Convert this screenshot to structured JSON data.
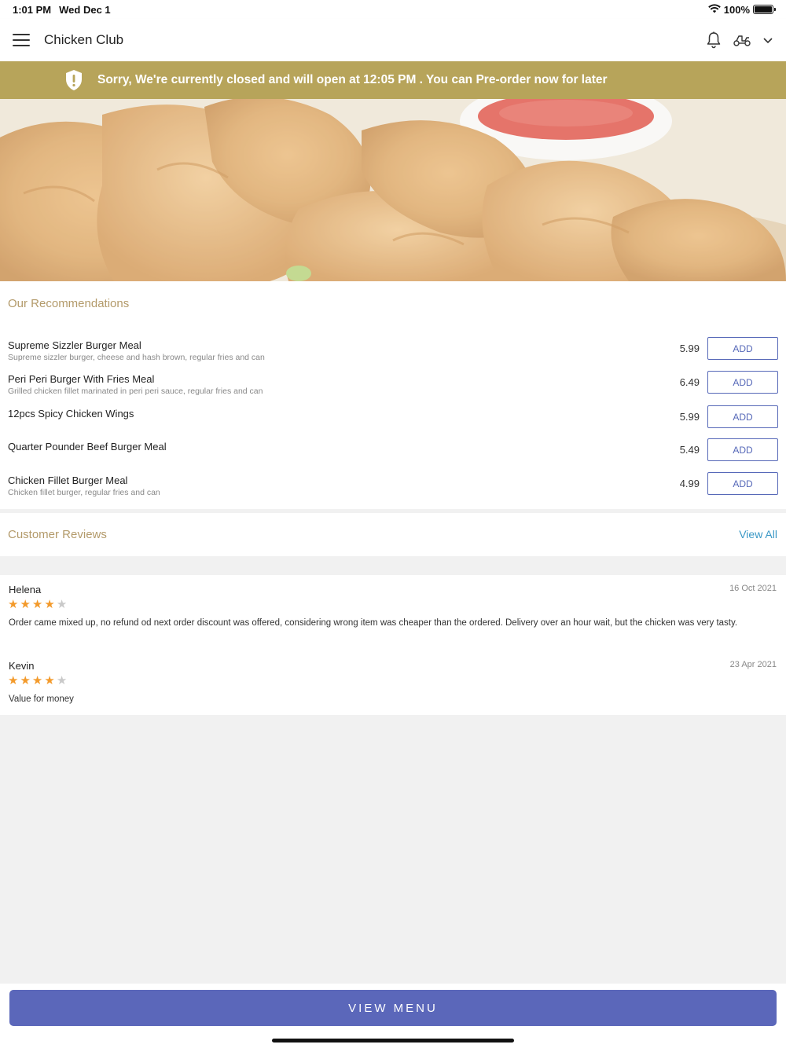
{
  "status_bar": {
    "time": "1:01 PM",
    "date": "Wed Dec 1",
    "battery": "100%"
  },
  "header": {
    "title": "Chicken Club",
    "icons": [
      "menu-icon",
      "bell-icon",
      "scooter-icon",
      "chevron-down-icon"
    ]
  },
  "banner": {
    "text": "Sorry, We're currently closed and will open at 12:05 PM . You can Pre-order now for later",
    "icon": "shield-alert-icon",
    "color": "#b7a45a"
  },
  "recommendations": {
    "title": "Our Recommendations",
    "add_label": "ADD",
    "items": [
      {
        "name": "Supreme Sizzler Burger Meal",
        "desc": "Supreme sizzler burger, cheese and hash brown, regular fries and can",
        "price": "5.99"
      },
      {
        "name": "Peri Peri Burger With Fries Meal",
        "desc": "Grilled chicken fillet marinated in peri peri sauce, regular fries and can",
        "price": "6.49"
      },
      {
        "name": "12pcs Spicy Chicken Wings",
        "desc": "",
        "price": "5.99"
      },
      {
        "name": "Quarter Pounder Beef Burger Meal",
        "desc": "",
        "price": "5.49"
      },
      {
        "name": "Chicken Fillet Burger Meal",
        "desc": "Chicken fillet burger, regular fries and can",
        "price": "4.99"
      }
    ]
  },
  "reviews": {
    "title": "Customer Reviews",
    "view_all": "View All",
    "items": [
      {
        "name": "Helena",
        "date": "16 Oct 2021",
        "rating": 4,
        "text": "Order came mixed up, no refund od next order discount was offered, considering wrong item was cheaper than the ordered. Delivery over an hour wait, but the chicken was very tasty."
      },
      {
        "name": "Kevin",
        "date": "23 Apr 2021",
        "rating": 4,
        "text": "Value for money"
      }
    ]
  },
  "footer": {
    "view_menu": "VIEW MENU"
  },
  "colors": {
    "accent": "#5b67ba",
    "section_title": "#b39a6a",
    "star": "#f39a2b",
    "link": "#3a98c6"
  }
}
